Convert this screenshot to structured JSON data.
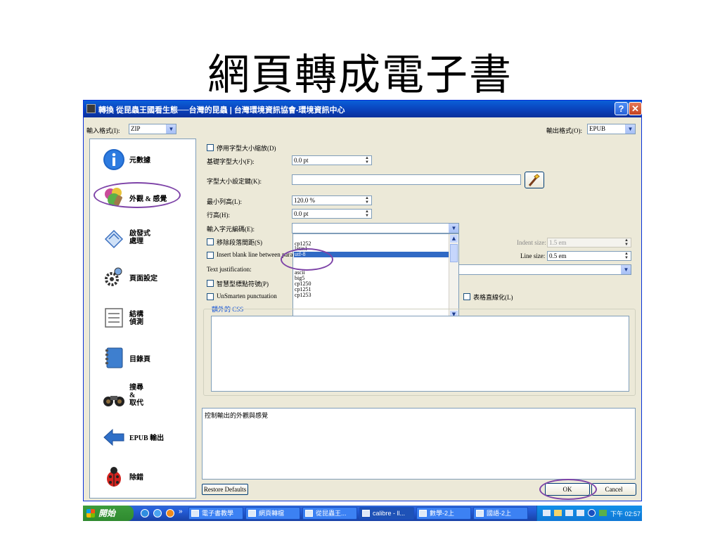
{
  "slide_title": "網頁轉成電子書",
  "window": {
    "title": "轉換 從昆蟲王國看生態──台灣的昆蟲 | 台灣環境資訊協會-環境資訊中心",
    "help_label": "?",
    "close_label": "✕"
  },
  "input_format": {
    "label": "輸入格式(I):",
    "value": "ZIP"
  },
  "output_format": {
    "label": "輸出格式(O):",
    "value": "EPUB"
  },
  "sidebar": {
    "items": [
      {
        "label": "元數據",
        "icon": "info-icon"
      },
      {
        "label": "外觀 & 感覺",
        "icon": "look-and-feel-icon"
      },
      {
        "label": "啟發式\n處理",
        "icon": "heuristics-icon"
      },
      {
        "label": "頁面設定",
        "icon": "page-setup-icon"
      },
      {
        "label": "結構\n偵測",
        "icon": "structure-icon"
      },
      {
        "label": "目錄頁",
        "icon": "toc-icon"
      },
      {
        "label": "搜尋\n&\n取代",
        "icon": "binoculars-icon"
      },
      {
        "label": "EPUB 輸出",
        "icon": "back-arrow-icon"
      },
      {
        "label": "除錯",
        "icon": "ladybug-icon"
      }
    ]
  },
  "form": {
    "disable_font_rescaling": "停用字型大小縮放(D)",
    "base_font_size_label": "基礎字型大小(F):",
    "base_font_size_value": "0.0 pt",
    "font_size_key_label": "字型大小設定鍵(K):",
    "font_size_key_value": "",
    "min_line_height_label": "最小列高(L):",
    "min_line_height_value": "120.0 %",
    "line_height_label": "行高(H):",
    "line_height_value": "0.0 pt",
    "input_encoding_label": "輸入字元編碼(E):",
    "input_encoding_value": "",
    "remove_paragraph_spacing": "移除段落間距(S)",
    "insert_blank_line": "Insert blank line between paragraphs",
    "text_justification_label": "Text justification:",
    "smarten_punctuation": "智慧型標點符號(P)",
    "unsmarten_punctuation": "UnSmarten punctuation",
    "linearize_tables": "表格直線化(L)",
    "indent_size_label": "Indent size:",
    "indent_size_value": "1.5 em",
    "line_size_label": "Line size:",
    "line_size_value": "0.5 em",
    "extra_css_label": "額外的 CSS",
    "extra_css_value": ""
  },
  "encoding_dropdown": {
    "options_top": [
      "cp1252",
      "latin1",
      "utf-8"
    ],
    "selected": "utf-8",
    "options_bottom": [
      "ascii",
      "big5",
      "cp1250",
      "cp1251",
      "cp1253"
    ]
  },
  "help_text": "控制輸出的外觀與感覺",
  "buttons": {
    "restore_defaults": "Restore Defaults",
    "ok": "OK",
    "cancel": "Cancel"
  },
  "taskbar": {
    "start_label": "開始",
    "quick_launch_more": "»",
    "items": [
      {
        "label": "電子書教學",
        "active": false
      },
      {
        "label": "網頁轉檔",
        "active": false
      },
      {
        "label": "從昆蟲王...",
        "active": false
      },
      {
        "label": "calibre - ll...",
        "active": true
      },
      {
        "label": "數學-2上",
        "active": false
      },
      {
        "label": "國語-2上",
        "active": false
      }
    ],
    "clock": "下午 02:57"
  },
  "colors": {
    "titlebar_blue": "#0a3fb8",
    "selection_blue": "#316ac5",
    "highlight_ellipse": "#7e44a8",
    "dialog_bg": "#ece9d8"
  }
}
